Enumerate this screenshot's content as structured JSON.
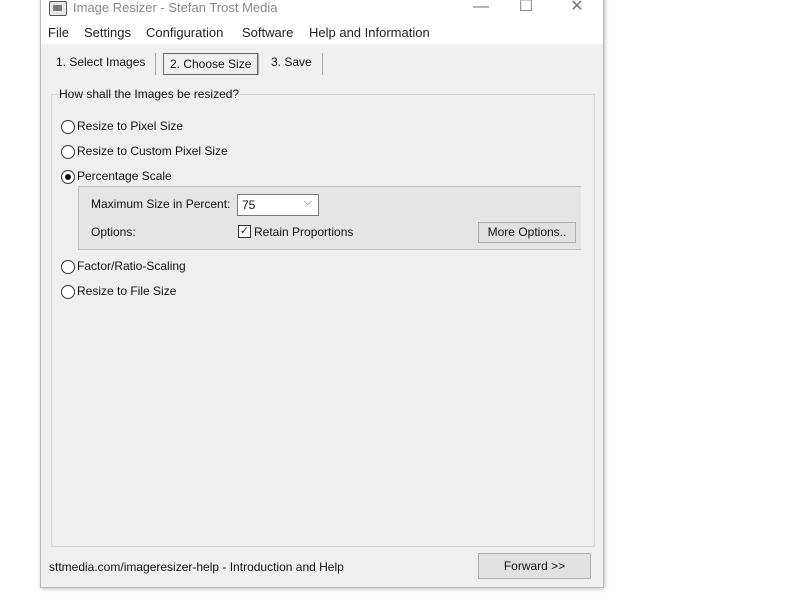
{
  "window": {
    "title": "Image Resizer - Stefan Trost Media",
    "controls": {
      "minimize": "—",
      "maximize": "☐",
      "close": "✕"
    }
  },
  "menu": [
    "File",
    "Settings",
    "Configuration",
    "Software",
    "Help and Information"
  ],
  "tabs": [
    "1. Select Images",
    "2. Choose Size",
    "3. Save"
  ],
  "active_tab": "2. Choose Size",
  "question": "How shall the Images be resized?",
  "options": [
    {
      "label": "Resize to Pixel Size",
      "checked": false
    },
    {
      "label": "Resize to Custom Pixel Size",
      "checked": false
    },
    {
      "label": "Percentage Scale",
      "checked": true
    },
    {
      "label": "Factor/Ratio-Scaling",
      "checked": false
    },
    {
      "label": "Resize to File Size",
      "checked": false
    }
  ],
  "percentage": {
    "max_label": "Maximum Size in Percent:",
    "max_value": "75",
    "options_label": "Options:",
    "retain_label": "Retain Proportions",
    "retain_checked": true,
    "more_options": "More Options.."
  },
  "footer": {
    "help_link": "sttmedia.com/imageresizer-help - Introduction and Help",
    "forward_button": "Forward >>"
  }
}
